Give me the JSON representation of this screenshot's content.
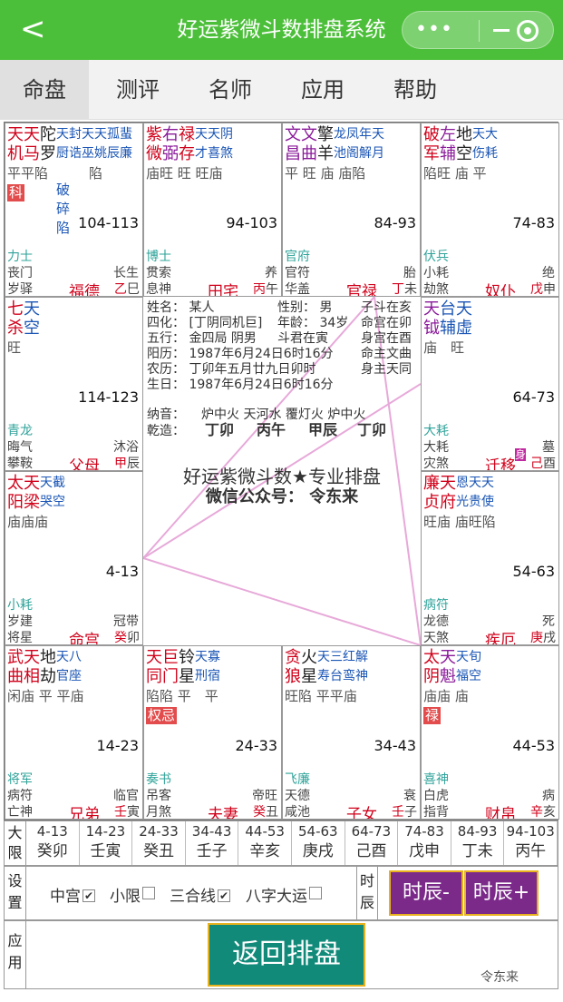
{
  "header": {
    "back": "<",
    "title": "好运紫微斗数排盘系统",
    "more": "•••"
  },
  "tabs": [
    "命盘",
    "测评",
    "名师",
    "应用",
    "帮助"
  ],
  "cells": {
    "si": {
      "r1": [
        [
          "天",
          "red"
        ],
        [
          "天",
          "red"
        ],
        [
          "陀",
          "blk"
        ],
        [
          "天封天天孤蜚",
          "blue sm"
        ]
      ],
      "r2": [
        [
          "机",
          "red"
        ],
        [
          "马",
          "red"
        ],
        [
          "罗",
          "blk"
        ],
        [
          "厨诰巫姚辰廉",
          "blue sm"
        ]
      ],
      "bright": "平平陷　　　陷",
      "badge": "科",
      "extra": [
        "破",
        "碎",
        "陷"
      ],
      "range": "104-113",
      "god1": "力士",
      "god2": "丧门",
      "god3": "岁驿",
      "phase": "长生",
      "palace": "福德",
      "stem_gan": "乙",
      "stem_zhi": "巳"
    },
    "wu": {
      "r1": [
        [
          "紫",
          "red"
        ],
        [
          "右",
          "purple"
        ],
        [
          "禄",
          "red"
        ],
        [
          "天天阴",
          "blue sm"
        ]
      ],
      "r2": [
        [
          "微",
          "red"
        ],
        [
          "弼",
          "purple"
        ],
        [
          "存",
          "red"
        ],
        [
          "才喜煞",
          "blue sm"
        ]
      ],
      "bright": "庙旺 旺 旺庙",
      "range": "94-103",
      "god1": "博士",
      "god2": "贯索",
      "god3": "息神",
      "phase": "养",
      "palace": "田宅",
      "stem_gan": "丙",
      "stem_zhi": "午"
    },
    "wei": {
      "r1": [
        [
          "文",
          "purple"
        ],
        [
          "文",
          "purple"
        ],
        [
          "擎",
          "blk"
        ],
        [
          "龙凤年天",
          "blue sm"
        ]
      ],
      "r2": [
        [
          "昌",
          "purple"
        ],
        [
          "曲",
          "purple"
        ],
        [
          "羊",
          "blk"
        ],
        [
          "池阁解月",
          "blue sm"
        ]
      ],
      "bright": "平 旺 庙 庙陷",
      "range": "84-93",
      "god1": "官府",
      "god2": "官符",
      "god3": "华盖",
      "phase": "胎",
      "palace": "官禄",
      "stem_gan": "丁",
      "stem_zhi": "未"
    },
    "shen": {
      "r1": [
        [
          "破",
          "red"
        ],
        [
          "左",
          "purple"
        ],
        [
          "地",
          "blk"
        ],
        [
          "天大",
          "blue sm"
        ]
      ],
      "r2": [
        [
          "军",
          "red"
        ],
        [
          "辅",
          "purple"
        ],
        [
          "空",
          "blk"
        ],
        [
          "伤耗",
          "blue sm"
        ]
      ],
      "bright": "陷旺 庙 平",
      "range": "74-83",
      "god1": "伏兵",
      "god2": "小耗",
      "god3": "劫煞",
      "phase": "绝",
      "palace": "奴仆",
      "stem_gan": "戊",
      "stem_zhi": "申"
    },
    "chen": {
      "r1": [
        [
          "七",
          "red"
        ],
        [
          "天",
          "blue"
        ]
      ],
      "r2": [
        [
          "杀",
          "red"
        ],
        [
          "空",
          "blue"
        ]
      ],
      "bright": "旺",
      "range": "114-123",
      "god1": "青龙",
      "god2": "晦气",
      "god3": "攀鞍",
      "phase": "沐浴",
      "palace": "父母",
      "stem_gan": "甲",
      "stem_zhi": "辰"
    },
    "you": {
      "r1": [
        [
          "天",
          "purple"
        ],
        [
          "台",
          "blue"
        ],
        [
          "天",
          "blue"
        ]
      ],
      "r2": [
        [
          "钺",
          "purple"
        ],
        [
          "辅",
          "blue"
        ],
        [
          "虚",
          "blue"
        ]
      ],
      "bright": "庙　旺",
      "range": "64-73",
      "god1": "大耗",
      "god2": "大耗",
      "god3": "灾煞",
      "phase": "墓",
      "palace": "迁移",
      "stem_gan": "己",
      "stem_zhi": "酉",
      "mark": "身"
    },
    "mao": {
      "r1": [
        [
          "太",
          "red"
        ],
        [
          "天",
          "red"
        ],
        [
          "天截",
          "blue sm"
        ]
      ],
      "r2": [
        [
          "阳",
          "red"
        ],
        [
          "梁",
          "red"
        ],
        [
          "哭空",
          "blue sm"
        ]
      ],
      "bright": "庙庙庙",
      "range": "4-13",
      "god1": "小耗",
      "god2": "岁建",
      "god3": "将星",
      "phase": "冠带",
      "palace": "命宫",
      "stem_gan": "癸",
      "stem_zhi": "卯"
    },
    "xu": {
      "r1": [
        [
          "廉",
          "red"
        ],
        [
          "天",
          "red"
        ],
        [
          "恩天天",
          "blue sm"
        ]
      ],
      "r2": [
        [
          "贞",
          "red"
        ],
        [
          "府",
          "red"
        ],
        [
          "光贵使",
          "blue sm"
        ]
      ],
      "bright": "旺庙 庙旺陷",
      "range": "54-63",
      "god1": "病符",
      "god2": "龙德",
      "god3": "天煞",
      "phase": "死",
      "palace": "疾厄",
      "stem_gan": "庚",
      "stem_zhi": "戌"
    },
    "yin": {
      "r1": [
        [
          "武",
          "red"
        ],
        [
          "天",
          "red"
        ],
        [
          "地",
          "blk"
        ],
        [
          "天八",
          "blue sm"
        ]
      ],
      "r2": [
        [
          "曲",
          "red"
        ],
        [
          "相",
          "red"
        ],
        [
          "劫",
          "blk"
        ],
        [
          "官座",
          "blue sm"
        ]
      ],
      "bright": "闲庙 平 平庙",
      "range": "14-23",
      "god1": "将军",
      "god2": "病符",
      "god3": "亡神",
      "phase": "临官",
      "palace": "兄弟",
      "stem_gan": "壬",
      "stem_zhi": "寅"
    },
    "chou": {
      "r1": [
        [
          "天",
          "red"
        ],
        [
          "巨",
          "red"
        ],
        [
          "铃",
          "blk"
        ],
        [
          "天寡",
          "blue sm"
        ]
      ],
      "r2": [
        [
          "同",
          "red"
        ],
        [
          "门",
          "red"
        ],
        [
          "星",
          "blk"
        ],
        [
          "刑宿",
          "blue sm"
        ]
      ],
      "bright": "陷陷 平　平",
      "badge": "权忌",
      "range": "24-33",
      "god1": "奏书",
      "god2": "吊客",
      "god3": "月煞",
      "phase": "帝旺",
      "palace": "夫妻",
      "stem_gan": "癸",
      "stem_zhi": "丑"
    },
    "zi": {
      "r1": [
        [
          "贪",
          "red"
        ],
        [
          "火",
          "blk"
        ],
        [
          "天三红解",
          "blue sm"
        ]
      ],
      "r2": [
        [
          "狼",
          "red"
        ],
        [
          "星",
          "blk"
        ],
        [
          "寿台鸾神",
          "blue sm"
        ]
      ],
      "bright": "旺陷 平平庙",
      "range": "34-43",
      "god1": "飞廉",
      "god2": "天德",
      "god3": "咸池",
      "phase": "衰",
      "palace": "子女",
      "stem_gan": "壬",
      "stem_zhi": "子"
    },
    "hai": {
      "r1": [
        [
          "太",
          "red"
        ],
        [
          "天",
          "purple"
        ],
        [
          "天旬",
          "blue sm"
        ]
      ],
      "r2": [
        [
          "阴",
          "red"
        ],
        [
          "魁",
          "purple"
        ],
        [
          "福空",
          "blue sm"
        ]
      ],
      "bright": "庙庙 庙",
      "badge": "禄",
      "range": "44-53",
      "god1": "喜神",
      "god2": "白虎",
      "god3": "指背",
      "phase": "病",
      "palace": "财帛",
      "stem_gan": "辛",
      "stem_zhi": "亥"
    }
  },
  "center": {
    "name": "姓名：  某人",
    "gender": "性别：  男",
    "ming_zhu": "子斗在亥",
    "sihua": "四化：  [丁阴同机巨]",
    "age": "年龄：  34岁",
    "ming_gong": "命宫在卯",
    "wuxing": "五行：  金四局  阴男",
    "doujun": "斗君在寅",
    "shen_gong": "身宫在酉",
    "solar": "阳历：  1987年6月24日6时16分",
    "ming_star": "命主文曲",
    "lunar": "农历：  丁卯年五月廿九日卯时",
    "shen_star": "身主天同",
    "birth": "生日：  1987年6月24日6时16分",
    "nayin_label": "纳音：",
    "nayin": "炉中火  天河水  覆灯火  炉中火",
    "qianzao_label": "乾造：",
    "pillars": [
      "丁卯",
      "丙午",
      "甲辰",
      "丁卯"
    ],
    "title": "好运紫微斗数★专业排盘",
    "subtitle": "微信公众号：  令东来"
  },
  "decade": {
    "label": "大限",
    "items": [
      {
        "range": "4-13",
        "gz": "癸卯"
      },
      {
        "range": "14-23",
        "gz": "壬寅"
      },
      {
        "range": "24-33",
        "gz": "癸丑"
      },
      {
        "range": "34-43",
        "gz": "壬子"
      },
      {
        "range": "44-53",
        "gz": "辛亥"
      },
      {
        "range": "54-63",
        "gz": "庚戌"
      },
      {
        "range": "64-73",
        "gz": "己酉"
      },
      {
        "range": "74-83",
        "gz": "戊申"
      },
      {
        "range": "84-93",
        "gz": "丁未"
      },
      {
        "range": "94-103",
        "gz": "丙午"
      }
    ]
  },
  "settings": {
    "label": "设置",
    "options": [
      {
        "label": "中宫",
        "checked": true
      },
      {
        "label": "小限",
        "checked": false
      },
      {
        "label": "三合线",
        "checked": true
      },
      {
        "label": "八字大运",
        "checked": false
      }
    ],
    "time_label": "时辰",
    "prev": "时辰-",
    "next": "时辰+"
  },
  "app": {
    "label": "应用",
    "return": "返回排盘"
  },
  "watermark": "令东来",
  "colors": {
    "header": "#4cbf3a",
    "red": "#d0021b",
    "blue": "#1a55b5",
    "purple": "#8a1a9a",
    "button_purple": "#7b2a8a",
    "button_teal": "#128a7a",
    "button_border": "#e8b21f",
    "sanhe_line": "#e7a9d9"
  }
}
